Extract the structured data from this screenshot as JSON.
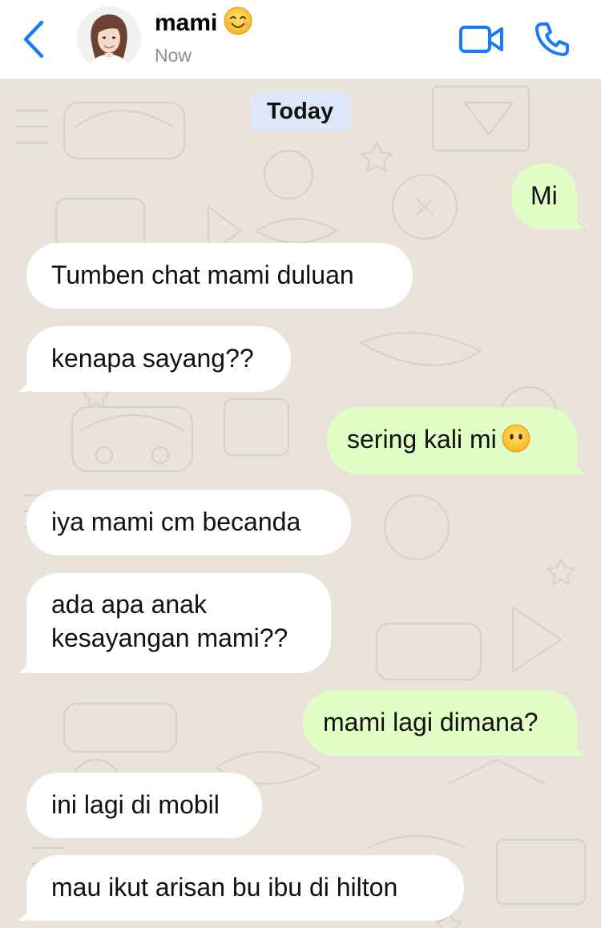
{
  "header": {
    "contact_name": "mami",
    "contact_status": "Now",
    "name_emoji": "smiling-face-icon",
    "icons": {
      "back": "chevron-left-icon",
      "video": "video-camera-icon",
      "call": "phone-icon"
    }
  },
  "chat": {
    "date_separator": "Today",
    "messages": [
      {
        "direction": "outgoing",
        "text": "Mi"
      },
      {
        "direction": "incoming",
        "text": "Tumben chat mami duluan"
      },
      {
        "direction": "incoming",
        "text": "kenapa sayang??"
      },
      {
        "direction": "outgoing",
        "text": "sering kali mi",
        "emoji": "face-without-mouth-icon"
      },
      {
        "direction": "incoming",
        "text": "iya mami cm becanda"
      },
      {
        "direction": "incoming",
        "lines": [
          "ada apa anak",
          "kesayangan mami??"
        ]
      },
      {
        "direction": "outgoing",
        "text": "mami lagi dimana?"
      },
      {
        "direction": "incoming",
        "text": "ini lagi di mobil"
      },
      {
        "direction": "incoming",
        "text": "mau ikut arisan bu ibu di hilton"
      }
    ]
  },
  "colors": {
    "accent": "#1a7cf5",
    "incoming_bubble": "#ffffff",
    "outgoing_bubble": "#e1fec6",
    "wallpaper": "#e9e3da",
    "date_pill": "#dde7f7",
    "status_text": "#8e8e93"
  }
}
